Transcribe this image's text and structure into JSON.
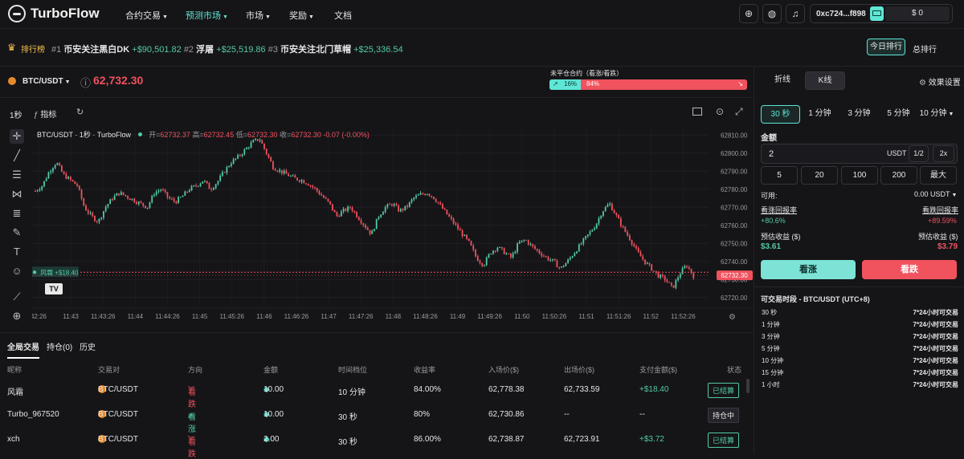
{
  "brand": "TurboFlow",
  "nav": {
    "items": [
      "合约交易",
      "预测市场",
      "市场",
      "奖励",
      "文档"
    ],
    "address": "0xc724...f898",
    "balance": "$ 0"
  },
  "ticker": {
    "label": "排行榜",
    "entries": [
      {
        "rank": "#1",
        "name": "币安关注黑白DK",
        "amount": "+$90,501.82"
      },
      {
        "rank": "#2",
        "name": "浮屠",
        "amount": "+$25,519.86"
      },
      {
        "rank": "#3",
        "name": "币安关注北门草帽",
        "amount": "+$25,336.54"
      }
    ],
    "today_btn": "今日排行",
    "total_btn": "总排行"
  },
  "pair": {
    "symbol": "BTC/USDT",
    "price": "62,732.30",
    "oi_label": "未平仓合约（看涨/看跌）",
    "up_pct": "16%",
    "down_pct": "84%"
  },
  "toolbar": {
    "interval": "1秒",
    "indicator": "指标"
  },
  "chart_tabs": {
    "line": "折线",
    "kline": "K线",
    "settings": "效果设置"
  },
  "legend": {
    "title": "BTC/USDT · 1秒 · TurboFlow",
    "open_label": "开=",
    "open": "62732.37",
    "high_label": "高=",
    "high": "62732.45",
    "low_label": "低=",
    "low": "62732.30",
    "close_label": "收=",
    "close": "62732.30",
    "change": "-0.07 (-0.00%)"
  },
  "chart_data": {
    "type": "candlestick",
    "symbol": "BTC/USDT",
    "interval": "1s",
    "ylim": [
      62715,
      62815
    ],
    "yticks": [
      "62810.00",
      "62800.00",
      "62790.00",
      "62780.00",
      "62770.00",
      "62760.00",
      "62750.00",
      "62740.00",
      "62730.00",
      "62720.00"
    ],
    "xticks": [
      "42:26",
      "11:43",
      "11:43:26",
      "11:44",
      "11:44:26",
      "11:45",
      "11:45:26",
      "11:46",
      "11:46:26",
      "11:47",
      "11:47:26",
      "11:48",
      "11:48:26",
      "11:49",
      "11:49:26",
      "11:50",
      "11:50:26",
      "11:51",
      "11:51:26",
      "11:52",
      "11:52:26",
      "11:53"
    ],
    "last_price": "62732.30",
    "marker_label": "风霜 +$18.40",
    "marker_price": 62734,
    "path": [
      62779,
      62782,
      62790,
      62795,
      62788,
      62785,
      62782,
      62770,
      62765,
      62762,
      62770,
      62775,
      62778,
      62776,
      62774,
      62772,
      62770,
      62778,
      62780,
      62775,
      62773,
      62776,
      62780,
      62782,
      62785,
      62780,
      62784,
      62790,
      62795,
      62798,
      62802,
      62806,
      62808,
      62800,
      62792,
      62790,
      62788,
      62786,
      62785,
      62783,
      62780,
      62776,
      62772,
      62765,
      62768,
      62770,
      62765,
      62760,
      62755,
      62765,
      62770,
      62772,
      62768,
      62770,
      62775,
      62777,
      62778,
      62775,
      62770,
      62765,
      62760,
      62755,
      62750,
      62742,
      62738,
      62745,
      62748,
      62745,
      62742,
      62750,
      62752,
      62748,
      62745,
      62742,
      62740,
      62736,
      62740,
      62745,
      62750,
      62755,
      62760,
      62768,
      62772,
      62765,
      62758,
      62752,
      62745,
      62740,
      62736,
      62732,
      62730,
      62725,
      62733,
      62738,
      62732
    ]
  },
  "bet": {
    "durations": [
      "30 秒",
      "1 分钟",
      "3 分钟",
      "5 分钟",
      "10 分钟"
    ],
    "amount_label": "金额",
    "amount": "2",
    "unit": "USDT",
    "half": "1/2",
    "double": "2x",
    "presets": [
      "5",
      "20",
      "100",
      "200",
      "最大"
    ],
    "available_label": "可用:",
    "available": "0.00 USDT",
    "up_rate_label": "看涨回报率",
    "up_rate": "+80.6%",
    "down_rate_label": "看跌回报率",
    "down_rate": "+89.59%",
    "up_profit_label": "预估收益 ($)",
    "up_profit": "$3.61",
    "down_profit_label": "预估收益 ($)",
    "down_profit": "$3.79",
    "up_btn": "看涨",
    "down_btn": "看跌"
  },
  "schedule": {
    "title": "可交易时段 - BTC/USDT (UTC+8)",
    "rows": [
      {
        "d": "30 秒",
        "t": "7*24小时可交易"
      },
      {
        "d": "1 分钟",
        "t": "7*24小时可交易"
      },
      {
        "d": "3 分钟",
        "t": "7*24小时可交易"
      },
      {
        "d": "5 分钟",
        "t": "7*24小时可交易"
      },
      {
        "d": "10 分钟",
        "t": "7*24小时可交易"
      },
      {
        "d": "15 分钟",
        "t": "7*24小时可交易"
      },
      {
        "d": "1 小时",
        "t": "7*24小时可交易"
      }
    ]
  },
  "trades_tabs": [
    "全局交易",
    "持仓(0)",
    "历史"
  ],
  "table": {
    "headers": [
      "昵称",
      "交易对",
      "方向",
      "金额",
      "时间档位",
      "收益率",
      "入场价($)",
      "出场价($)",
      "支付金额($)",
      "状态"
    ],
    "rows": [
      {
        "nick": "风霜",
        "pair": "BTC/USDT",
        "dir": "看跌",
        "dir_type": "down",
        "amount": "10.00",
        "time": "10 分钟",
        "rate": "84.00%",
        "entry": "62,778.38",
        "exit": "62,733.59",
        "payout": "+$18.40",
        "status": "已结算",
        "status_type": "settled"
      },
      {
        "nick": "Turbo_967520",
        "pair": "BTC/USDT",
        "dir": "看涨",
        "dir_type": "up",
        "amount": "10.00",
        "time": "30 秒",
        "rate": "80%",
        "entry": "62,730.86",
        "exit": "--",
        "payout": "--",
        "status": "持仓中",
        "status_type": "open"
      },
      {
        "nick": "xch",
        "pair": "BTC/USDT",
        "dir": "看跌",
        "dir_type": "down",
        "amount": "2.00",
        "time": "30 秒",
        "rate": "86.00%",
        "entry": "62,738.87",
        "exit": "62,723.91",
        "payout": "+$3.72",
        "status": "已结算",
        "status_type": "settled"
      }
    ]
  }
}
